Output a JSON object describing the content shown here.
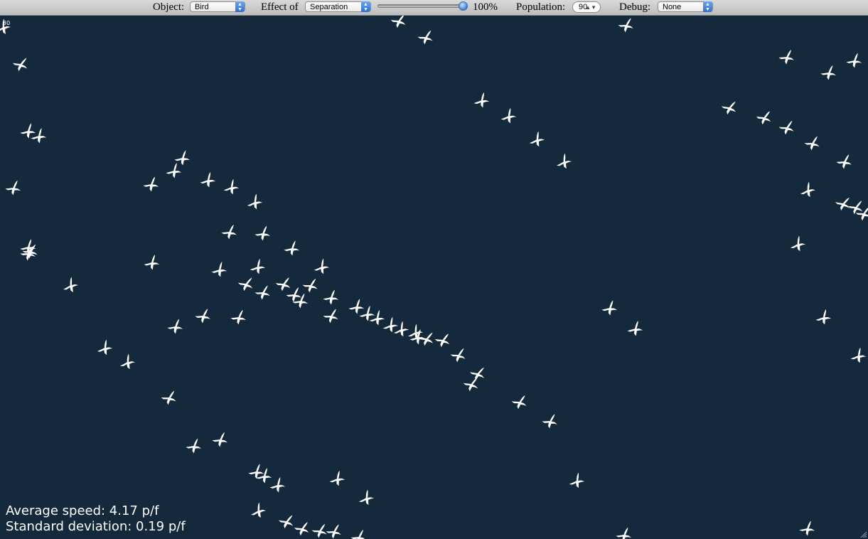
{
  "toolbar": {
    "object_label": "Object:",
    "object_value": "Bird",
    "effect_label": "Effect of",
    "effect_value": "Separation",
    "slider_percent_text": "100%",
    "slider_fraction": 1.0,
    "population_label": "Population:",
    "population_value": "90",
    "debug_label": "Debug:",
    "debug_value": "None"
  },
  "fps_text": "30",
  "stats": {
    "average_speed": "Average speed: 4.17 p/f",
    "standard_deviation": "Standard deviation: 0.19 p/f"
  },
  "colors": {
    "background": "#14293b",
    "bird": "#ffffff",
    "toolbar": "#cccccc",
    "select_accent": "#2f6fd0"
  },
  "icons": {
    "bird": "bird-icon",
    "resize": "resize-grip-icon",
    "stepper": "stepper-arrows-icon"
  }
}
